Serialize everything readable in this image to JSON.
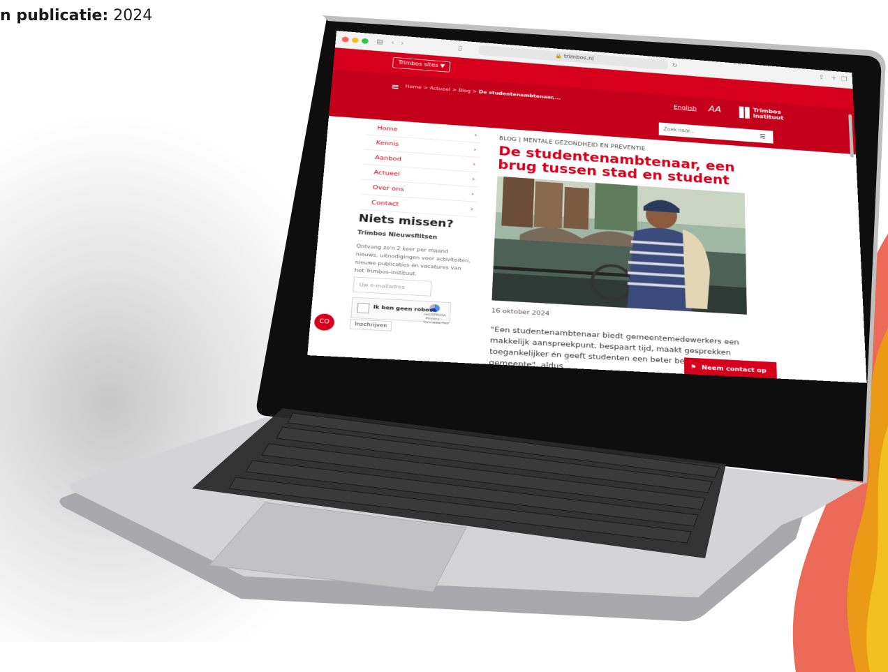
{
  "caption": {
    "label": "n publicatie:",
    "value": "2024"
  },
  "browser": {
    "url": "trimbos.nl"
  },
  "site": {
    "sites_button": "Trimbos sites",
    "breadcrumb": {
      "home": "Home",
      "actueel": "Actueel",
      "blog": "Blog",
      "current": "De studentenambtenaar,..."
    },
    "language_link": "English",
    "text_size_label": "AA",
    "logo_text": "Trimbos instituut",
    "search_placeholder": "Zoek naar...",
    "nav": [
      "Home",
      "Kennis",
      "Aanbod",
      "Actueel",
      "Over ons",
      "Contact"
    ],
    "newsletter": {
      "title": "Niets missen?",
      "subtitle": "Trimbos Nieuwsflitsen",
      "text": "Ontvang zo'n 2 keer per maand nieuws, uitnodigingen voor activiteiten, nieuwe publicaties en vacatures van het Trimbos-instituut.",
      "email_placeholder": "Uw e-mailadres",
      "captcha_label": "Ik ben geen robot",
      "captcha_brand": "reCAPTCHA",
      "captcha_links": "Privacy - Voorwaarden",
      "subscribe": "Inschrijven"
    },
    "article": {
      "meta": "BLOG | MENTALE GEZONDHEID EN PREVENTIE",
      "title": "De studentenambtenaar, een brug tussen stad en student",
      "date": "16 oktober 2024",
      "intro": "\"Een studentenambtenaar biedt gemeentemedewerkers een makkelijk aanspreekpunt, bespaart tijd, maakt gesprekken toegankelijker én geeft studenten een beter beeld van de gemeente\", aldus"
    },
    "contact_button": "Neem contact op",
    "cookie_badge": "CO"
  },
  "colors": {
    "brand_red": "#d6001c",
    "dark_red": "#c4001b",
    "accent_orange": "#e8683f",
    "accent_yellow": "#f0b323"
  }
}
